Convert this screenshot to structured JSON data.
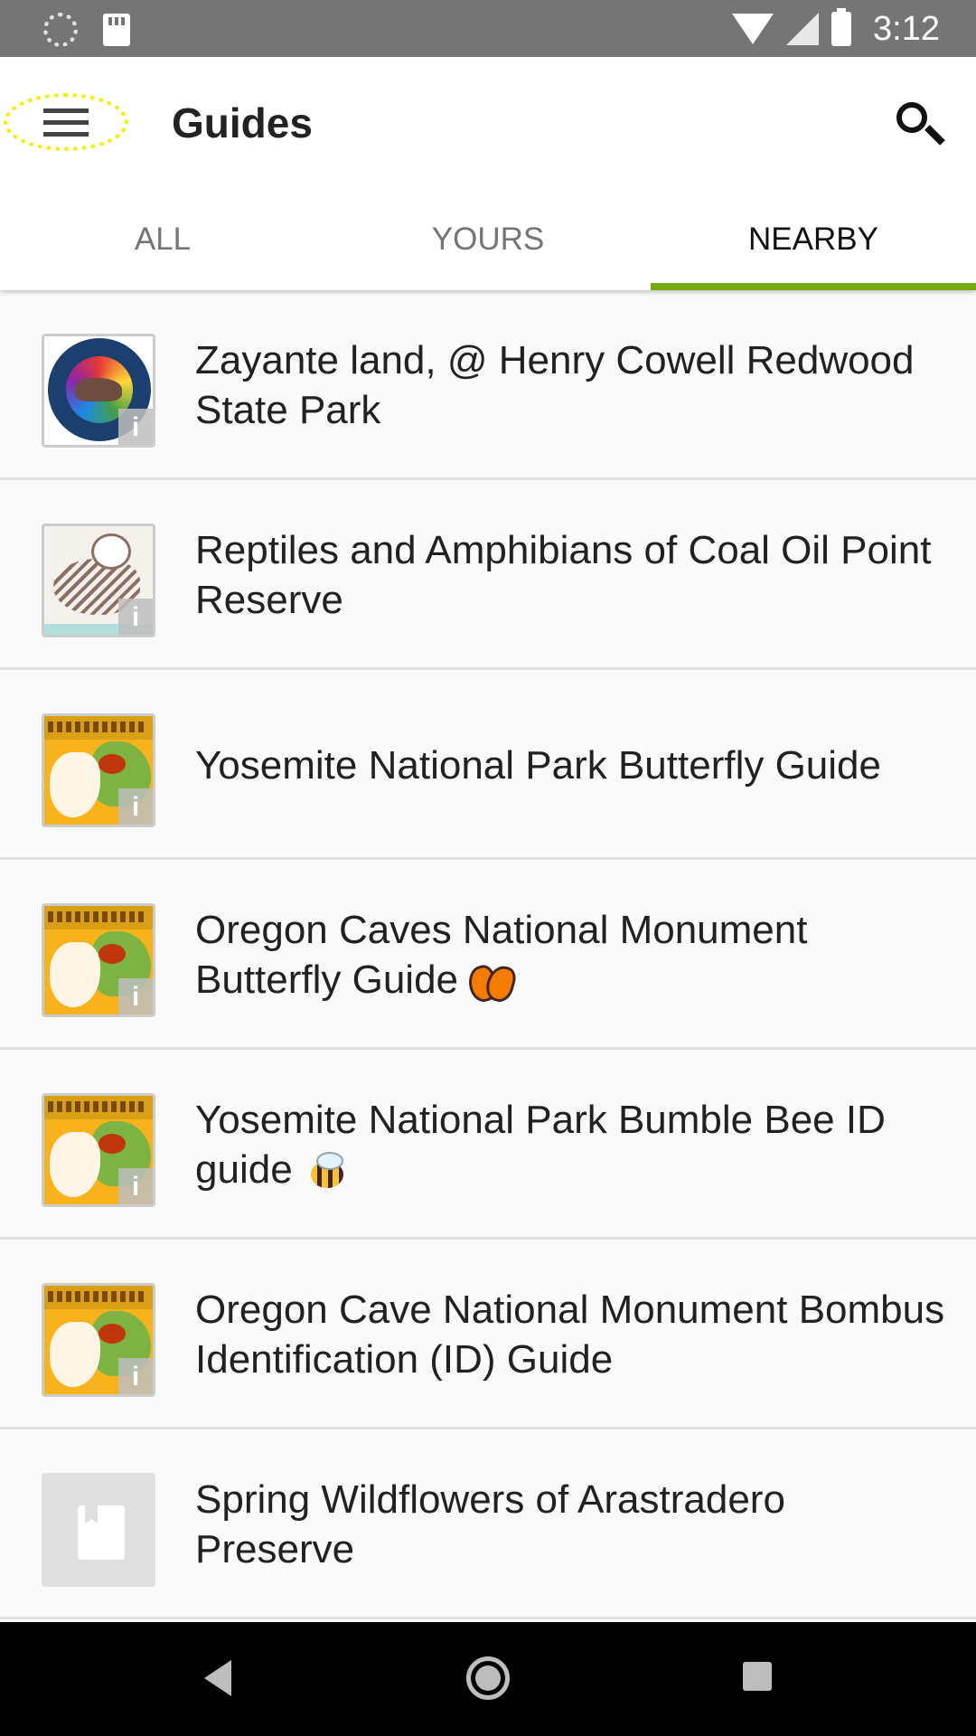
{
  "status_bar": {
    "time": "3:12",
    "icons": [
      "sync-icon",
      "sd-card-icon",
      "wifi-icon",
      "signal-icon",
      "battery-icon"
    ]
  },
  "app_bar": {
    "title": "Guides",
    "menu_icon": "hamburger-menu-icon",
    "search_icon": "search-icon"
  },
  "tabs": [
    {
      "label": "ALL",
      "active": false
    },
    {
      "label": "YOURS",
      "active": false
    },
    {
      "label": "NEARBY",
      "active": true
    }
  ],
  "accent_color": "#74ac00",
  "guides": [
    {
      "title": "Zayante land, @ Henry Cowell Redwood State Park",
      "thumbnail": "california-state-parks-seal",
      "info_badge": "i"
    },
    {
      "title": "Reptiles and Amphibians of Coal Oil Point Reserve",
      "thumbnail": "bird-sketch",
      "info_badge": "i"
    },
    {
      "title": "Yosemite National Park Butterfly Guide",
      "thumbnail": "pollinator-hotshots",
      "info_badge": "i"
    },
    {
      "title": "Oregon Caves National Monument Butterfly Guide",
      "emoji": "butterfly",
      "thumbnail": "pollinator-hotshots",
      "info_badge": "i"
    },
    {
      "title": "Yosemite National Park Bumble Bee ID guide",
      "emoji": "bee",
      "thumbnail": "pollinator-hotshots",
      "info_badge": "i"
    },
    {
      "title": "Oregon Cave National Monument Bombus Identification (ID) Guide",
      "thumbnail": "pollinator-hotshots",
      "info_badge": "i"
    },
    {
      "title": "Spring Wildflowers of Arastradero Preserve",
      "thumbnail": "placeholder-book"
    }
  ],
  "nav_bar": {
    "icons": [
      "back-icon",
      "home-icon",
      "recents-icon"
    ]
  }
}
